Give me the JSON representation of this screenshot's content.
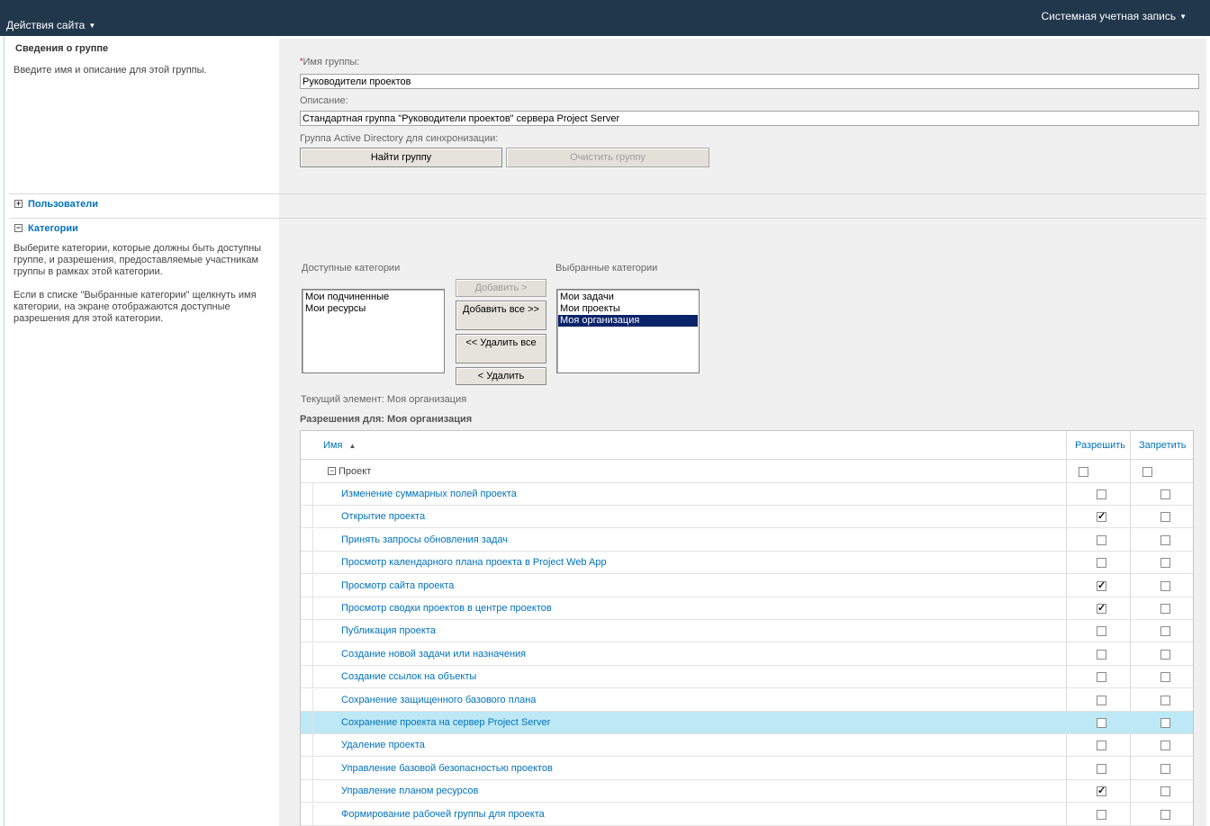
{
  "topbar": {
    "site_actions": "Действия сайта",
    "account": "Системная учетная запись"
  },
  "group_info": {
    "title": "Сведения о группе",
    "description": "Введите имя и описание для этой группы.",
    "name_label": "Имя группы:",
    "name_value": "Руководители проектов",
    "desc_label": "Описание:",
    "desc_value": "Стандартная группа \"Руководители проектов\" сервера Project Server",
    "ad_label": "Группа Active Directory для синхронизации:",
    "find_button": "Найти группу",
    "clear_button": "Очистить группу"
  },
  "users": {
    "title": "Пользователи",
    "expander": "+"
  },
  "categories": {
    "title": "Категории",
    "expander": "−",
    "desc1": "Выберите категории, которые должны быть доступны группе, и разрешения, предоставляемые участникам группы в рамках этой категории.",
    "desc2": "Если в списке \"Выбранные категории\" щелкнуть имя категории, на экране отображаются доступные разрешения для этой категории.",
    "available_label": "Доступные категории",
    "selected_label": "Выбранные категории",
    "available": [
      "Мои подчиненные",
      "Мои ресурсы"
    ],
    "selected": [
      "Мои задачи",
      "Мои проекты",
      "Моя организация"
    ],
    "selected_active": "Моя организация",
    "add_button": "Добавить >",
    "add_all_button": "Добавить все >>",
    "remove_all_button": "<< Удалить все",
    "remove_button": "< Удалить",
    "current_item": "Текущий элемент: Моя организация",
    "permissions_for_label": "Разрешения для:",
    "permissions_for_value": "Моя организация"
  },
  "grid": {
    "col_name": "Имя",
    "col_allow": "Разрешить",
    "col_deny": "Запретить",
    "sort_icon": "▲",
    "group_label": "Проект",
    "group_expander": "−",
    "rows": [
      {
        "name": "Изменение суммарных полей проекта",
        "allow": false,
        "deny": false
      },
      {
        "name": "Открытие проекта",
        "allow": true,
        "deny": false
      },
      {
        "name": "Принять запросы обновления задач",
        "allow": false,
        "deny": false
      },
      {
        "name": "Просмотр календарного плана проекта в Project Web App",
        "allow": false,
        "deny": false
      },
      {
        "name": "Просмотр сайта проекта",
        "allow": true,
        "deny": false
      },
      {
        "name": "Просмотр сводки проектов в центре проектов",
        "allow": true,
        "deny": false
      },
      {
        "name": "Публикация проекта",
        "allow": false,
        "deny": false
      },
      {
        "name": "Создание новой задачи или назначения",
        "allow": false,
        "deny": false
      },
      {
        "name": "Создание ссылок на объекты",
        "allow": false,
        "deny": false
      },
      {
        "name": "Сохранение защищенного базового плана",
        "allow": false,
        "deny": false
      },
      {
        "name": "Сохранение проекта на сервер Project Server",
        "allow": false,
        "deny": false,
        "highlight": true
      },
      {
        "name": "Удаление проекта",
        "allow": false,
        "deny": false
      },
      {
        "name": "Управление базовой безопасностью проектов",
        "allow": false,
        "deny": false
      },
      {
        "name": "Управление планом ресурсов",
        "allow": true,
        "deny": false
      },
      {
        "name": "Формирование рабочей группы для проекта",
        "allow": false,
        "deny": false
      }
    ]
  }
}
